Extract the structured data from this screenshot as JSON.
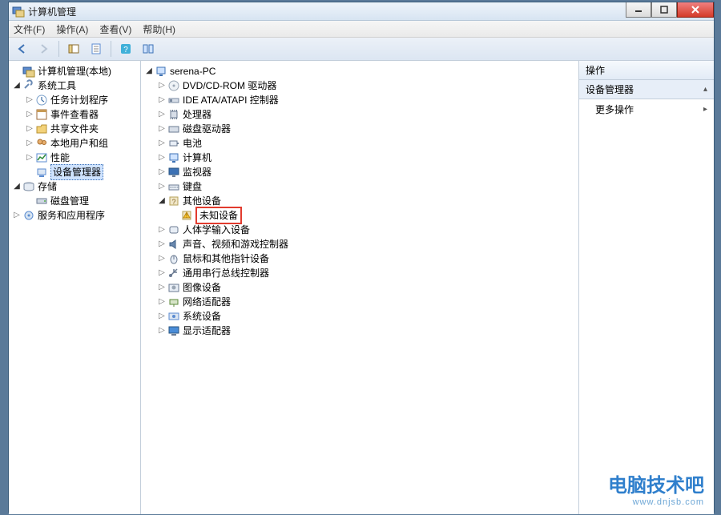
{
  "title": "计算机管理",
  "menus": {
    "file": "文件(F)",
    "action": "操作(A)",
    "view": "查看(V)",
    "help": "帮助(H)"
  },
  "left_tree": {
    "root": "计算机管理(本地)",
    "groups": [
      {
        "label": "系统工具",
        "children": [
          {
            "label": "任务计划程序",
            "icon": "clock"
          },
          {
            "label": "事件查看器",
            "icon": "event"
          },
          {
            "label": "共享文件夹",
            "icon": "folder"
          },
          {
            "label": "本地用户和组",
            "icon": "users"
          },
          {
            "label": "性能",
            "icon": "perf"
          },
          {
            "label": "设备管理器",
            "icon": "device",
            "selected": true
          }
        ]
      },
      {
        "label": "存储",
        "children": [
          {
            "label": "磁盘管理",
            "icon": "disk"
          }
        ]
      },
      {
        "label": "服务和应用程序",
        "leaf": true
      }
    ]
  },
  "center_tree": {
    "root": "serena-PC",
    "items": [
      {
        "label": "DVD/CD-ROM 驱动器",
        "icon": "dvd"
      },
      {
        "label": "IDE ATA/ATAPI 控制器",
        "icon": "ide"
      },
      {
        "label": "处理器",
        "icon": "cpu"
      },
      {
        "label": "磁盘驱动器",
        "icon": "diskdrv"
      },
      {
        "label": "电池",
        "icon": "battery"
      },
      {
        "label": "计算机",
        "icon": "pc"
      },
      {
        "label": "监视器",
        "icon": "monitor"
      },
      {
        "label": "键盘",
        "icon": "kbd"
      },
      {
        "label": "其他设备",
        "icon": "other",
        "expanded": true,
        "children": [
          {
            "label": "未知设备",
            "icon": "warn",
            "highlight": true
          }
        ]
      },
      {
        "label": "人体学输入设备",
        "icon": "hid"
      },
      {
        "label": "声音、视频和游戏控制器",
        "icon": "sound"
      },
      {
        "label": "鼠标和其他指针设备",
        "icon": "mouse"
      },
      {
        "label": "通用串行总线控制器",
        "icon": "usb"
      },
      {
        "label": "图像设备",
        "icon": "image"
      },
      {
        "label": "网络适配器",
        "icon": "net"
      },
      {
        "label": "系统设备",
        "icon": "sys"
      },
      {
        "label": "显示适配器",
        "icon": "display"
      }
    ]
  },
  "actions_panel": {
    "header": "操作",
    "section": "设备管理器",
    "more": "更多操作"
  },
  "watermark": {
    "cn": "电脑技术吧",
    "url": "www.dnjsb.com"
  }
}
